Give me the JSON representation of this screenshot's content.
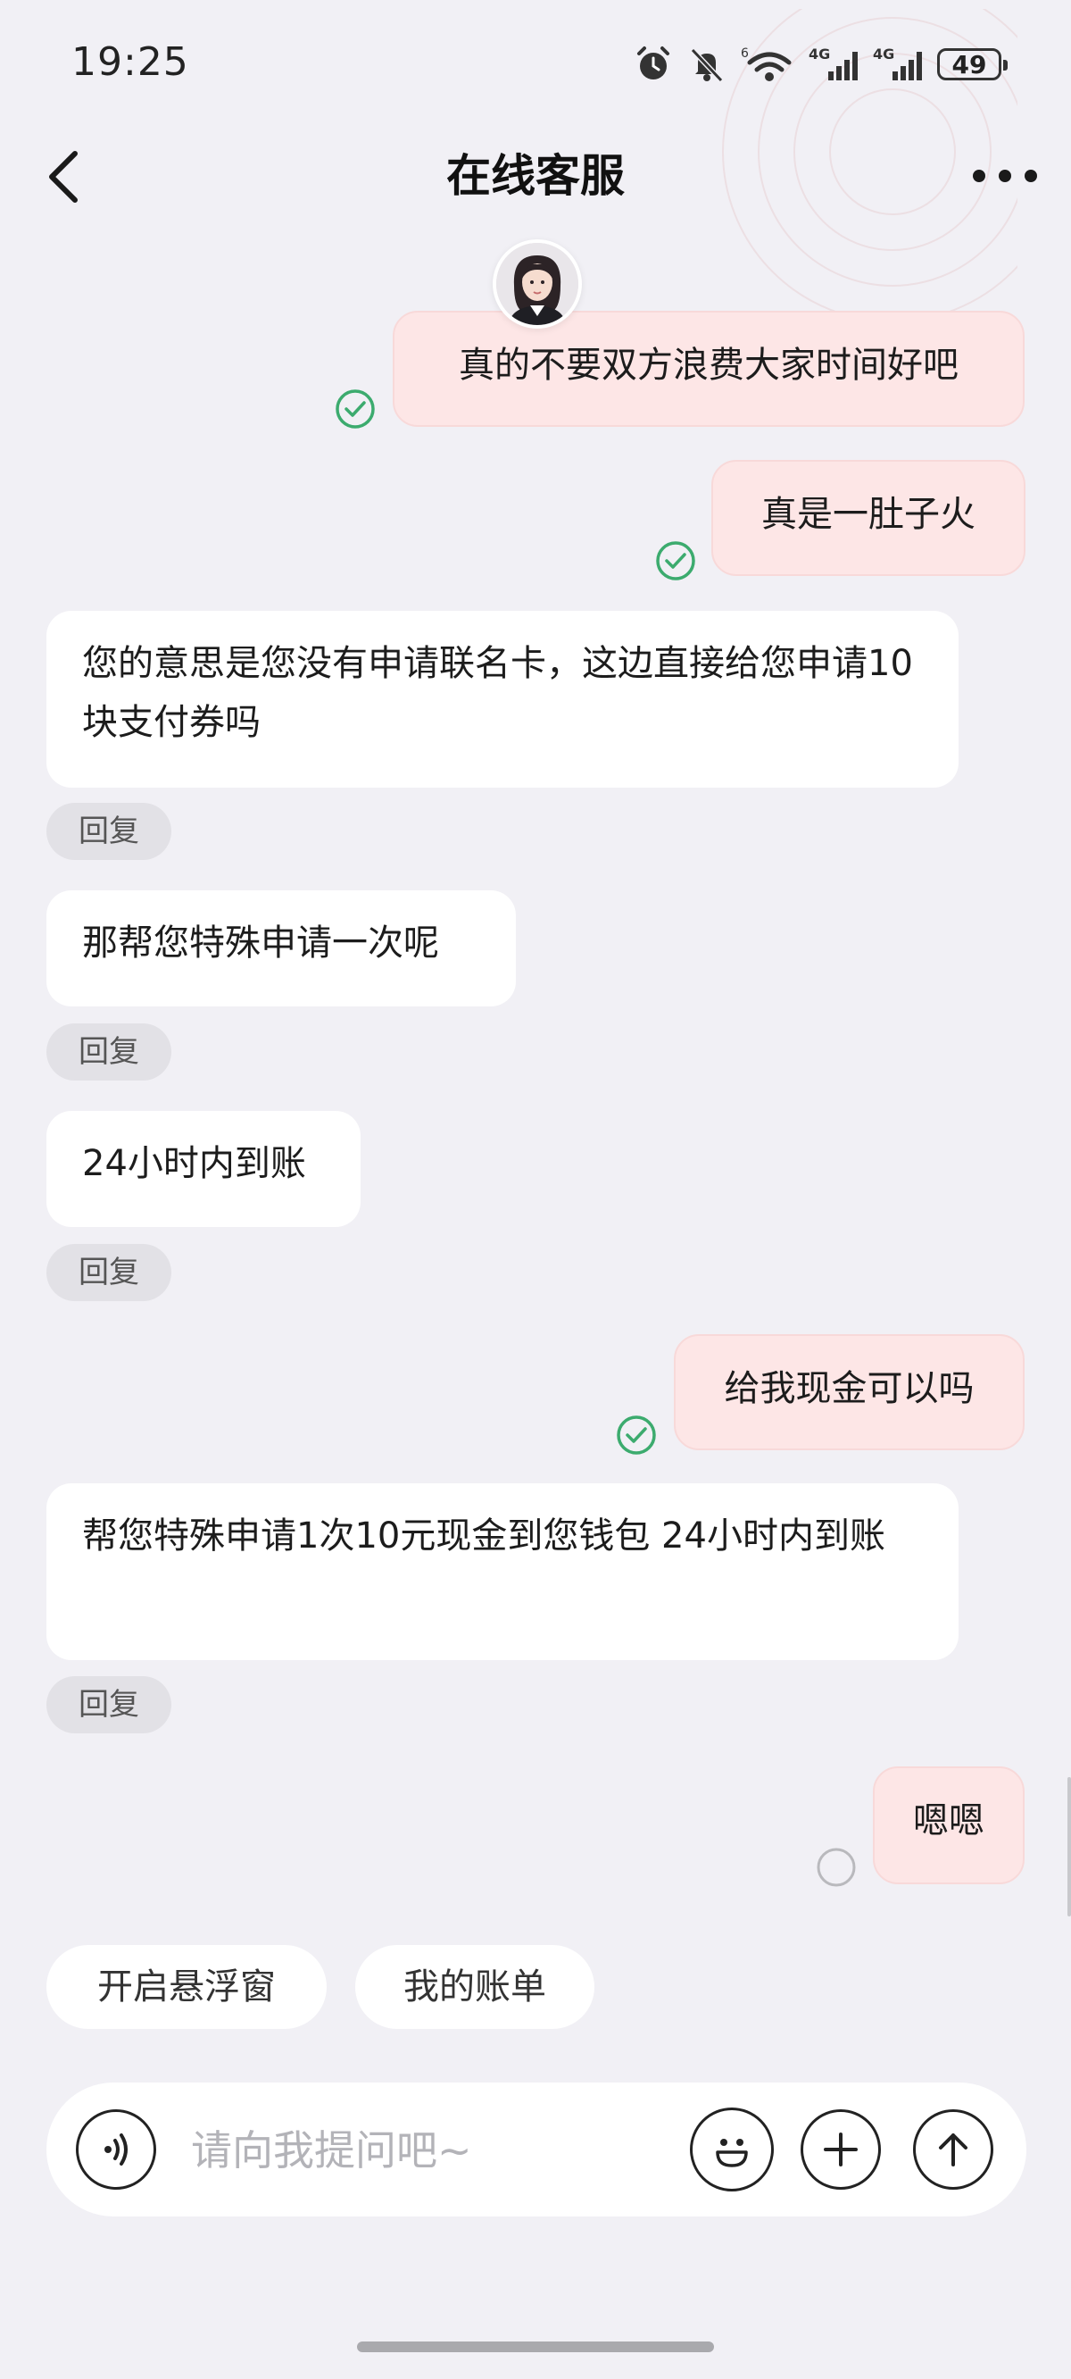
{
  "status_bar": {
    "time": "19:25",
    "network_label_1": "4G",
    "network_label_2": "4G",
    "wifi_label": "6",
    "battery": "49"
  },
  "nav": {
    "title": "在线客服",
    "back_icon": "chevron-left-icon",
    "more_icon": "more-horizontal-icon"
  },
  "messages": [
    {
      "role": "user",
      "text": "真的不要双方浪费大家时间好吧",
      "status": "read"
    },
    {
      "role": "user",
      "text": "真是一肚子火",
      "status": "read"
    },
    {
      "role": "agent",
      "text": "您的意思是您没有申请联名卡，这边直接给您申请10块支付券吗",
      "reply": "回复"
    },
    {
      "role": "agent",
      "text": "那帮您特殊申请一次呢",
      "reply": "回复"
    },
    {
      "role": "agent",
      "text": "24小时内到账",
      "reply": "回复"
    },
    {
      "role": "user",
      "text": "给我现金可以吗",
      "status": "read"
    },
    {
      "role": "agent",
      "text": "帮您特殊申请1次10元现金到您钱包 24小时内到账",
      "reply": "回复"
    },
    {
      "role": "user",
      "text": "嗯嗯",
      "status": "sending"
    }
  ],
  "quick_actions": [
    "开启悬浮窗",
    "我的账单"
  ],
  "input": {
    "placeholder": "请向我提问吧~",
    "value": "",
    "voice_icon": "voice-icon",
    "emoji_icon": "emoji-icon",
    "plus_icon": "plus-icon",
    "send_icon": "send-arrow-icon"
  },
  "colors": {
    "background": "#f1f0f5",
    "user_bubble": "#fde6e6",
    "agent_bubble": "#ffffff",
    "check_green": "#3cab6e",
    "reply_chip": "#e2e1e6"
  }
}
